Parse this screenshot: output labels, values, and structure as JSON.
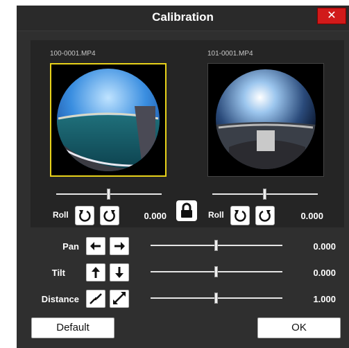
{
  "window": {
    "title": "Calibration",
    "close_label": "✕"
  },
  "cameras": [
    {
      "filename": "100-0001.MP4",
      "roll_label": "Roll",
      "roll_value": "0.000",
      "selected": true
    },
    {
      "filename": "101-0001.MP4",
      "roll_label": "Roll",
      "roll_value": "0.000",
      "selected": false
    }
  ],
  "adjustments": [
    {
      "label": "Pan",
      "value": "0.000"
    },
    {
      "label": "Tilt",
      "value": "0.000"
    },
    {
      "label": "Distance",
      "value": "1.000"
    }
  ],
  "buttons": {
    "default_label": "Default",
    "ok_label": "OK"
  },
  "colors": {
    "selection_border": "#e8d21a",
    "close_button": "#d11a1a",
    "window_bg": "#2f2f2f"
  }
}
